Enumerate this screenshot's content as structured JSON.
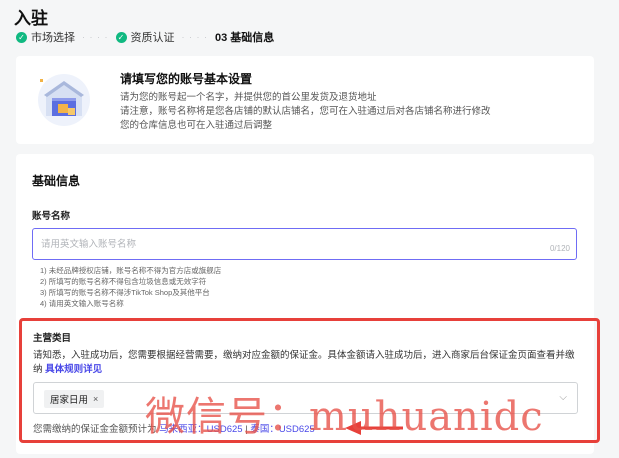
{
  "page_title": "入驻",
  "steps": [
    {
      "label": "市场选择",
      "done": true
    },
    {
      "label": "资质认证",
      "done": true
    },
    {
      "label": "03 基础信息",
      "done": false
    }
  ],
  "intro": {
    "title": "请填写您的账号基本设置",
    "lines": [
      "请为您的账号起一个名字，并提供您的首公里发货及退货地址",
      "请注意，账号名称将是您各店铺的默认店铺名，您可在入驻通过后对各店铺名称进行修改",
      "您的仓库信息也可在入驻通过后调整"
    ]
  },
  "form": {
    "section_title": "基础信息",
    "account_label": "账号名称",
    "account_placeholder": "请用英文输入账号名称",
    "account_value": "",
    "char_count": "0/120",
    "hints": [
      "1) 未经品牌授权店铺，账号名称不得为官方店或旗舰店",
      "2) 所填写的账号名称不得包含垃圾信息或无效字符",
      "3) 所填写的账号名称不得涉TikTok Shop及其他平台",
      "4) 请用英文输入账号名称"
    ]
  },
  "category": {
    "title": "主营类目",
    "desc": "请知悉，入驻成功后，您需要根据经营需要，缴纳对应金额的保证金。具体金额请入驻成功后，进入商家后台保证金页面查看并缴纳 ",
    "link": "具体规则详见",
    "selected_tag": "居家日用",
    "tag_remove": "×",
    "caret": "⌵",
    "deposit_prefix": "您需缴纳的保证金金额预计为 ",
    "deposit_country1": "马来西亚：USD625",
    "deposit_sep": " | ",
    "deposit_country2": "泰国：USD625"
  },
  "watermark": "微信号：muhuanidc",
  "colors": {
    "accent": "#6f6cf5",
    "link": "#4a49e8",
    "success": "#10b981",
    "highlight_red": "#e7403a"
  }
}
